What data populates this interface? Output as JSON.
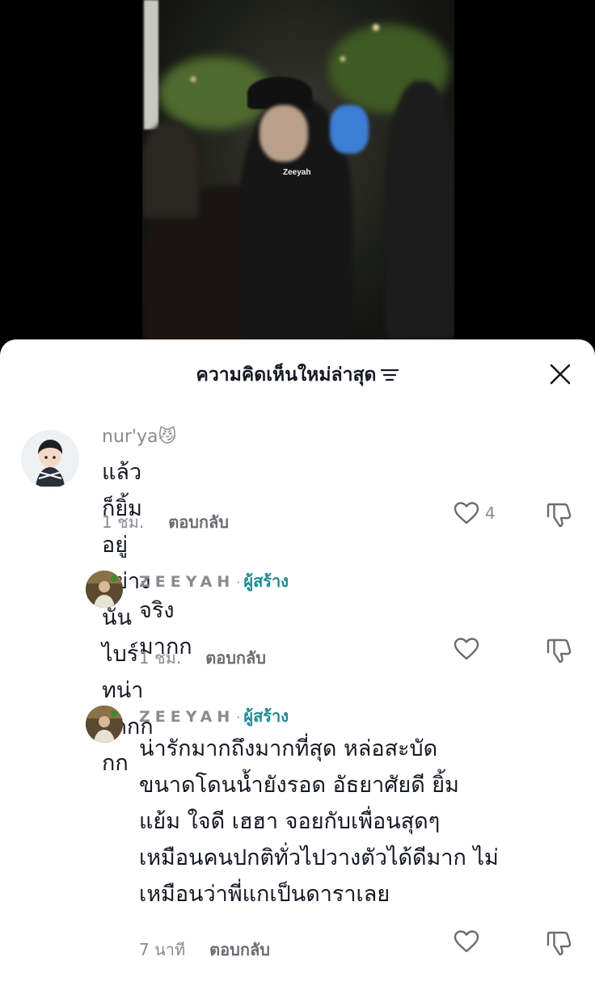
{
  "video": {
    "watermark": "Zeeyah"
  },
  "header": {
    "title": "ความคิดเห็นใหม่ล่าสุด"
  },
  "comments": [
    {
      "username": "nur'ya",
      "username_emoji": "😼",
      "text": "แล้วก็ยิ้มอยู่อย่างนั้น ไบร์ทน่ารักกกกก",
      "time": "1 ชม.",
      "reply_label": "ตอบกลับ",
      "likes": "4"
    },
    {
      "username": "ZEEYAH",
      "creator_label": "ผู้สร้าง",
      "text": "จริงมากก",
      "time": "1 ชม.",
      "reply_label": "ตอบกลับ"
    },
    {
      "username": "ZEEYAH",
      "creator_label": "ผู้สร้าง",
      "text_lines": [
        "น่ารักมากถึงมากที่สุด หล่อสะบัด",
        "ขนาดโดนน้ำยังรอด อัธยาศัยดี ยิ้ม",
        "แย้ม ใจดี เฮฮา จอยกับเพื่อนสุดๆ",
        "เหมือนคนปกติทั่วไปวางตัวได้ดีมาก ไม่",
        "เหมือนว่าพี่แกเป็นดาราเลย"
      ],
      "time": "7 นาที",
      "reply_label": "ตอบกลับ"
    }
  ],
  "colors": {
    "text_primary": "#161823",
    "text_secondary": "#8a8b91",
    "creator_accent": "#1f8a92"
  }
}
